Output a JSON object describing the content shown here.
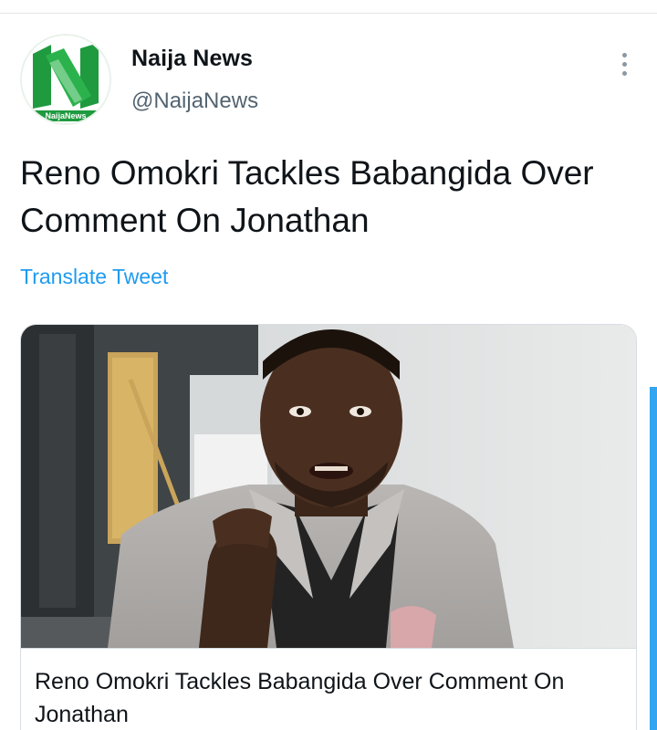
{
  "tweet": {
    "author": {
      "display_name": "Naija News",
      "handle": "@NaijaNews",
      "avatar_text": "NaijaNews",
      "avatar_icon": "naija-news-logo"
    },
    "more_icon": "more-vertical-icon",
    "text": "Reno Omokri Tackles Babangida Over Comment On Jonathan",
    "translate_label": "Translate Tweet",
    "link_card": {
      "title": "Reno Omokri Tackles Babangida Over Comment On Jonathan",
      "image_alt": "man in grey blazer speaking"
    }
  },
  "colors": {
    "accent": "#1d9bf0",
    "brand_green": "#1f9a3f",
    "text_primary": "#0f1419",
    "text_secondary": "#536471"
  }
}
